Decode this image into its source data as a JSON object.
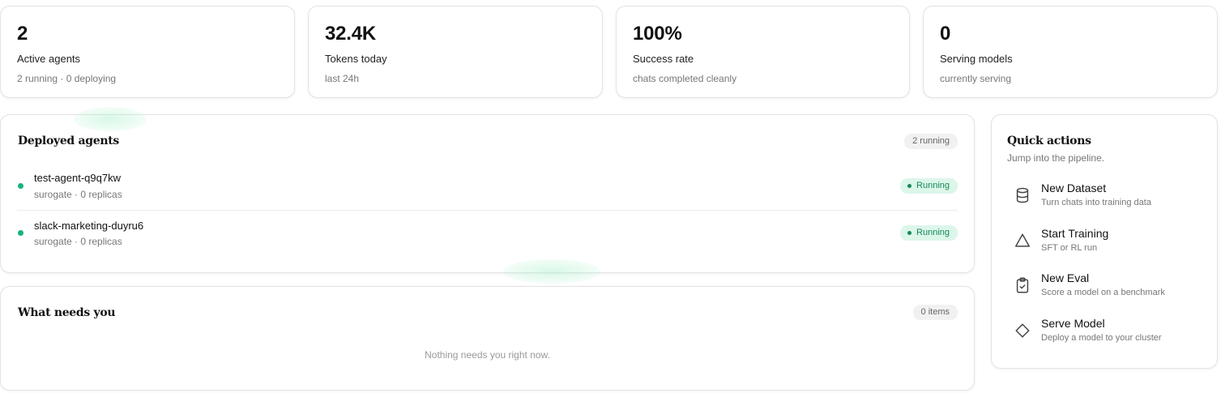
{
  "stats": [
    {
      "value": "2",
      "label": "Active agents",
      "sub": "2 running · 0 deploying"
    },
    {
      "value": "32.4K",
      "label": "Tokens today",
      "sub": "last 24h"
    },
    {
      "value": "100%",
      "label": "Success rate",
      "sub": "chats completed cleanly"
    },
    {
      "value": "0",
      "label": "Serving models",
      "sub": "currently serving"
    }
  ],
  "deployed": {
    "title": "Deployed agents",
    "count_badge": "2 running",
    "agents": [
      {
        "name": "test-agent-q9q7kw",
        "meta": "surogate · 0 replicas",
        "status": "Running"
      },
      {
        "name": "slack-marketing-duyru6",
        "meta": "surogate · 0 replicas",
        "status": "Running"
      }
    ],
    "status_color": "#16b37a"
  },
  "needs": {
    "title": "What needs you",
    "count_badge": "0 items",
    "empty_text": "Nothing needs you right now."
  },
  "quick_actions": {
    "title": "Quick actions",
    "subtitle": "Jump into the pipeline.",
    "items": [
      {
        "icon": "database-icon",
        "title": "New Dataset",
        "sub": "Turn chats into training data"
      },
      {
        "icon": "triangle-icon",
        "title": "Start Training",
        "sub": "SFT or RL run"
      },
      {
        "icon": "clipboard-check-icon",
        "title": "New Eval",
        "sub": "Score a model on a benchmark"
      },
      {
        "icon": "diamond-icon",
        "title": "Serve Model",
        "sub": "Deploy a model to your cluster"
      }
    ]
  }
}
